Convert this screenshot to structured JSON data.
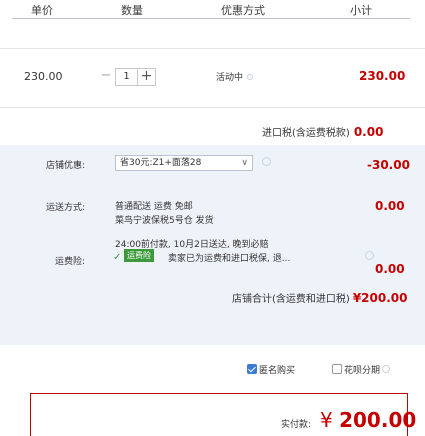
{
  "header": {
    "col_price": "单价",
    "col_qty": "数量",
    "col_promo": "优惠方式",
    "col_subtotal": "小计"
  },
  "item": {
    "price": "230.00",
    "qty_minus": "−",
    "qty_value": "1",
    "qty_plus": "+",
    "promo": "活动中",
    "subtotal": "230.00"
  },
  "tax": {
    "label": "进口税(含运费税款)",
    "amount": "0.00"
  },
  "coupon": {
    "label": "店铺优惠:",
    "selected": "省30元:Z1+面落28",
    "amount": "-30.00"
  },
  "shipping": {
    "label": "运送方式:",
    "line1": "普通配送 运费 免邮",
    "line2": "菜鸟宁波保税5号仓 发货",
    "line3": "24:00前付款, 10月2日送达, 晚到必赔",
    "amount": "0.00"
  },
  "insurance": {
    "label": "运费险:",
    "tag": "运费险",
    "text": "卖家已为运费和进口税保, 退...",
    "amount": "0.00"
  },
  "store_total": {
    "label": "店铺合计(含运费和进口税)",
    "amount": "¥200.00"
  },
  "options": {
    "anonymous": "匿名购买",
    "huabei": "花呗分期"
  },
  "pay": {
    "label": "实付款:",
    "currency": "¥",
    "amount": "200.00"
  },
  "colors": {
    "accent_red": "#c40000",
    "panel_bg": "#eef2f9",
    "checkbox_blue": "#3a7bd5",
    "insurance_green": "#3c9a3c"
  }
}
